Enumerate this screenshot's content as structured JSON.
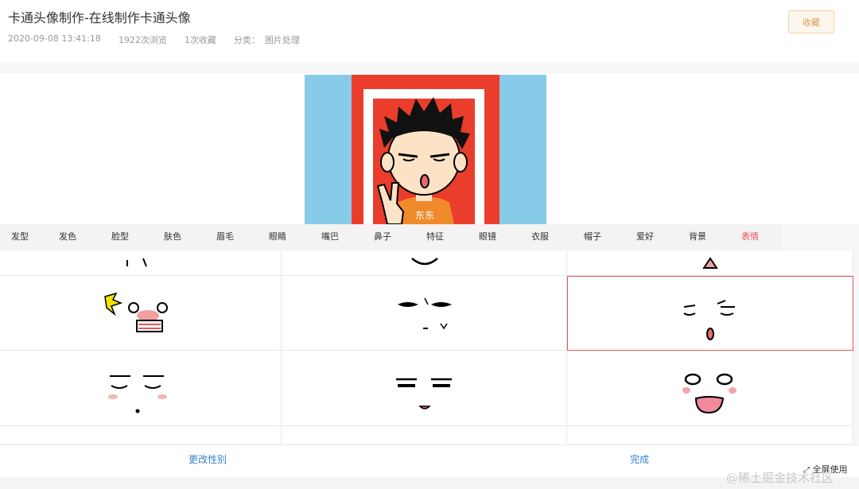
{
  "page": {
    "title": "卡通头像制作-在线制作卡通头像",
    "date": "2020-09-08 13:41:18",
    "views": "1922次浏览",
    "favorites": "1次收藏",
    "category_label": "分类：",
    "category": "图片处理",
    "favorite_button": "收藏"
  },
  "preview": {
    "shirt_text": "东东"
  },
  "tabs": [
    "发型",
    "发色",
    "脸型",
    "肤色",
    "眉毛",
    "眼睛",
    "嘴巴",
    "鼻子",
    "特征",
    "眼镜",
    "衣服",
    "帽子",
    "爱好",
    "背景",
    "表情"
  ],
  "active_tab": "表情",
  "bottom": {
    "change_gender": "更改性别",
    "done": "完成",
    "fullscreen": "全屏使用"
  },
  "watermark": "@稀土掘金技术社区",
  "colors": {
    "accent": "#e55555",
    "link": "#3a80d0",
    "preview_bg": "#87cbe8",
    "frame_red": "#ea3d2b"
  }
}
